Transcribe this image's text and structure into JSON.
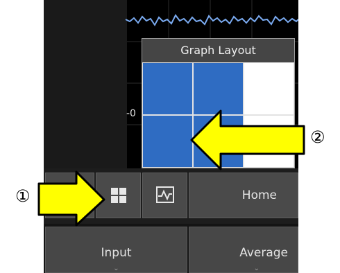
{
  "graph": {
    "y_tick_label": "-0"
  },
  "popup": {
    "title": "Graph Layout",
    "grid": {
      "rows": 2,
      "columns": 3,
      "selected_rows": 2,
      "selected_columns": 2
    }
  },
  "toolbar": {
    "layout_button_icon": "grid-layout-icon",
    "waveform_button_icon": "waveform-icon",
    "home_label": "Home"
  },
  "bottom_bar": {
    "input_label": "Input",
    "average_label": "Average"
  },
  "callouts": {
    "marker_1": "①",
    "marker_2": "②"
  },
  "colors": {
    "selected_cell": "#2f6cc2",
    "signal": "#7aaaf0",
    "arrow_fill": "#ffff00",
    "popup_title_bg": "#454545"
  }
}
